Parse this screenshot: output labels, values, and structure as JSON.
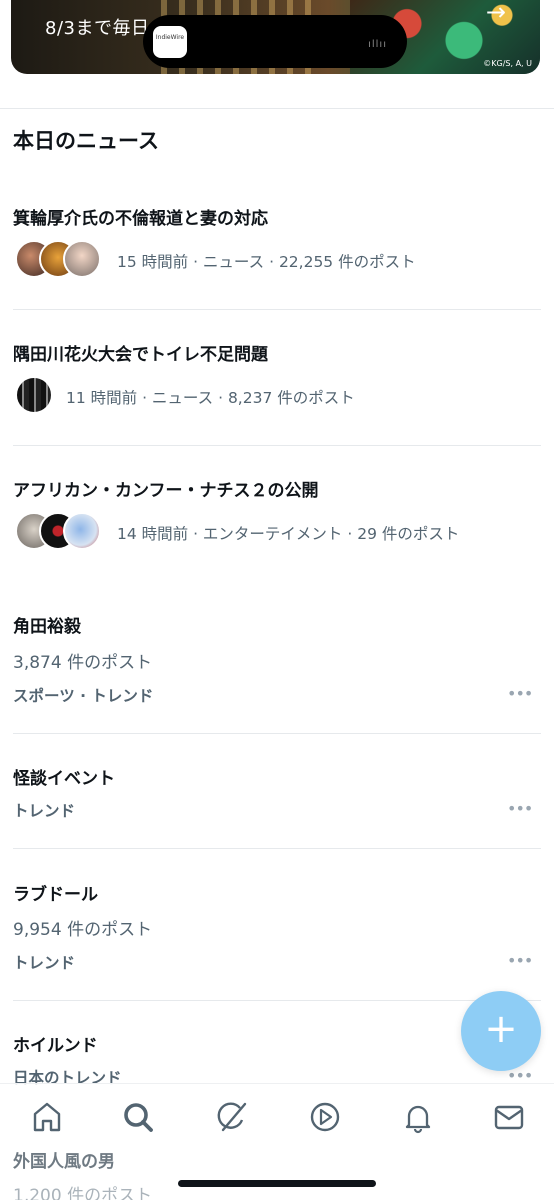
{
  "banner": {
    "caption": "8/3まで毎日",
    "credit": "©KG/S, A, U",
    "arrow": "→"
  },
  "island": {
    "app_label": "IndieWire"
  },
  "section_title": "本日のニュース",
  "news": [
    {
      "title": "箕輪厚介氏の不倫報道と妻の対応",
      "meta": "15 時間前 · ニュース · 22,255 件のポスト"
    },
    {
      "title": "隅田川花火大会でトイレ不足問題",
      "meta": "11 時間前 · ニュース · 8,237 件のポスト"
    },
    {
      "title": "アフリカン・カンフー・ナチス２の公開",
      "meta": "14 時間前 · エンターテイメント · 29 件のポスト"
    }
  ],
  "trends": [
    {
      "title": "角田裕毅",
      "count": "3,874 件のポスト",
      "category": "スポーツ · トレンド"
    },
    {
      "title": "怪談イベント",
      "count": "",
      "category": "トレンド"
    },
    {
      "title": "ラブドール",
      "count": "9,954 件のポスト",
      "category": "トレンド"
    },
    {
      "title": "ホイルンド",
      "count": "",
      "category": "日本のトレンド"
    },
    {
      "title": "外国人風の男",
      "count": "1,200 件のポスト",
      "category": ""
    }
  ],
  "more_glyph": "•••",
  "fab_glyph": "+",
  "tabs": [
    {
      "icon": "home-icon"
    },
    {
      "icon": "search-icon"
    },
    {
      "icon": "grok-icon"
    },
    {
      "icon": "video-icon"
    },
    {
      "icon": "notifications-icon"
    },
    {
      "icon": "messages-icon"
    }
  ],
  "colors": {
    "accent": "#1d9bf0",
    "fab": "#8ecdf5",
    "secondary_text": "#536471"
  }
}
